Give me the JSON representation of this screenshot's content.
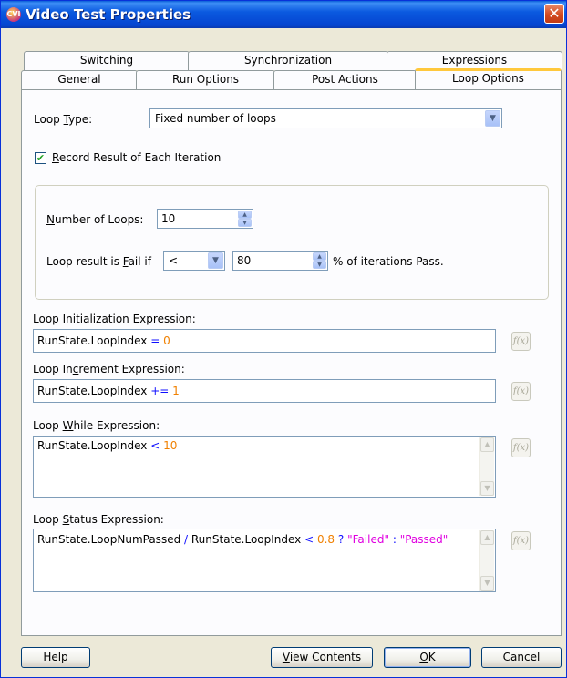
{
  "window": {
    "title": "Video Test Properties",
    "app_icon_text": "CVI"
  },
  "tabs": {
    "row1": [
      {
        "label": "Switching"
      },
      {
        "label": "Synchronization"
      },
      {
        "label": "Expressions"
      }
    ],
    "row2": [
      {
        "label": "General"
      },
      {
        "label": "Run Options"
      },
      {
        "label": "Post Actions"
      },
      {
        "label": "Loop Options",
        "active": true
      }
    ]
  },
  "loop_type": {
    "label_pre": "Loop ",
    "label_key": "T",
    "label_post": "ype:",
    "value": "Fixed number of loops"
  },
  "record_result": {
    "checked": true,
    "label_key": "R",
    "label_rest": "ecord Result of Each Iteration"
  },
  "num_loops": {
    "label_key": "N",
    "label_rest": "umber of Loops:",
    "value": "10"
  },
  "fail_condition": {
    "label_pre": "Loop result is ",
    "label_key": "F",
    "label_post": "ail if",
    "operator": "<",
    "percent": "80",
    "suffix": "% of iterations Pass."
  },
  "expressions": {
    "init": {
      "label_pre": "Loop ",
      "label_key": "I",
      "label_post": "nitialization Expression:",
      "tokens": [
        {
          "t": "RunState.LoopIndex ",
          "k": "id"
        },
        {
          "t": "=",
          "k": "op"
        },
        {
          "t": " ",
          "k": "id"
        },
        {
          "t": "0",
          "k": "num"
        }
      ]
    },
    "increment": {
      "label_pre": "Loop In",
      "label_key": "c",
      "label_post": "rement Expression:",
      "tokens": [
        {
          "t": "RunState.LoopIndex ",
          "k": "id"
        },
        {
          "t": "+=",
          "k": "op"
        },
        {
          "t": " ",
          "k": "id"
        },
        {
          "t": "1",
          "k": "num"
        }
      ]
    },
    "while": {
      "label_pre": "Loop ",
      "label_key": "W",
      "label_post": "hile Expression:",
      "tokens": [
        {
          "t": "RunState.LoopIndex ",
          "k": "id"
        },
        {
          "t": "<",
          "k": "op"
        },
        {
          "t": " ",
          "k": "id"
        },
        {
          "t": "10",
          "k": "num"
        }
      ]
    },
    "status": {
      "label_pre": "Loop ",
      "label_key": "S",
      "label_post": "tatus Expression:",
      "tokens": [
        {
          "t": "RunState.LoopNumPassed ",
          "k": "id"
        },
        {
          "t": "/",
          "k": "op"
        },
        {
          "t": " RunState.LoopIndex ",
          "k": "id"
        },
        {
          "t": "<",
          "k": "op"
        },
        {
          "t": " ",
          "k": "id"
        },
        {
          "t": "0.8",
          "k": "num"
        },
        {
          "t": " ",
          "k": "id"
        },
        {
          "t": "?",
          "k": "op"
        },
        {
          "t": " ",
          "k": "id"
        },
        {
          "t": "\"Failed\"",
          "k": "str"
        },
        {
          "t": " ",
          "k": "id"
        },
        {
          "t": ":",
          "k": "op"
        },
        {
          "t": " ",
          "k": "id"
        },
        {
          "t": "\"Passed\"",
          "k": "str"
        }
      ]
    },
    "fx_label": "f(x)"
  },
  "buttons": {
    "help": "Help",
    "view_contents_key": "V",
    "view_contents_rest": "iew Contents",
    "ok_key": "O",
    "ok_rest": "K",
    "cancel": "Cancel"
  },
  "colors": {
    "accent_tab": "#ffc83c",
    "title_bar": "#0546d2",
    "token_operator": "#1010ff",
    "token_number": "#f08000",
    "token_string": "#e000e0"
  }
}
